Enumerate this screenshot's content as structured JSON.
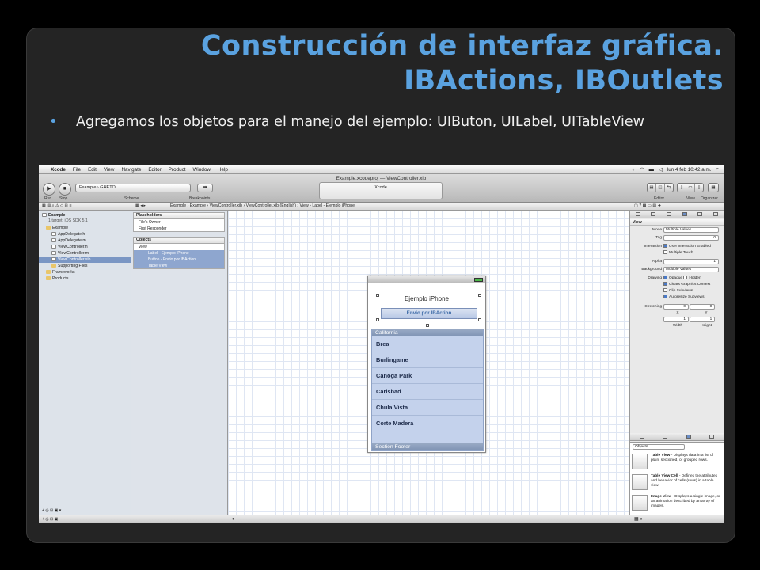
{
  "slide": {
    "title_line1": "Construcción de interfaz gráfica.",
    "title_line2": "IBActions, IBOutlets",
    "bullet": "Agregamos los objetos para el manejo del ejemplo: UIButon, UILabel, UITableView"
  },
  "menubar": {
    "apple": "",
    "items": [
      "Xcode",
      "File",
      "Edit",
      "View",
      "Navigate",
      "Editor",
      "Product",
      "Window",
      "Help"
    ],
    "clock": "lun 4 feb  10:42 a.m."
  },
  "window": {
    "title": "Example.xcodeproj — ViewController.xib",
    "activity": "Xcode",
    "run_label": "Run",
    "stop_label": "Stop",
    "scheme_value": "Example  ›  GHETO",
    "scheme_label": "Scheme",
    "breakpoints_label": "Breakpoints",
    "editor_label": "Editor",
    "view_label": "View",
    "organizer_label": "Organizer"
  },
  "jumpbar": {
    "path": "Example  ›  Example  ›  ViewController.xib  ›  ViewController.xib (English)  ›  View  ›  Label - Ejemplo iPhone"
  },
  "navigator": {
    "project": "Example",
    "project_sub": "1 target, iOS SDK 5.1",
    "items": [
      {
        "label": "Example",
        "kind": "folder",
        "indent": 1
      },
      {
        "label": "AppDelegate.h",
        "kind": "file",
        "indent": 2
      },
      {
        "label": "AppDelegate.m",
        "kind": "file",
        "indent": 2
      },
      {
        "label": "ViewController.h",
        "kind": "file",
        "indent": 2
      },
      {
        "label": "ViewController.m",
        "kind": "file",
        "indent": 2
      },
      {
        "label": "ViewController.xib",
        "kind": "file",
        "indent": 2,
        "selected": true
      },
      {
        "label": "Supporting Files",
        "kind": "folder",
        "indent": 2
      },
      {
        "label": "Frameworks",
        "kind": "folder",
        "indent": 1
      },
      {
        "label": "Products",
        "kind": "folder",
        "indent": 1
      }
    ]
  },
  "outline": {
    "placeholders_title": "Placeholders",
    "placeholders": [
      "File's Owner",
      "First Responder"
    ],
    "objects_title": "Objects",
    "view_label": "View",
    "children": [
      "Label - Ejemplo iPhone",
      "Button - Envio por IBAction",
      "Table View"
    ]
  },
  "canvas": {
    "label_text": "Ejemplo iPhone",
    "button_text": "Envio por IBAction",
    "section_header": "California",
    "cities": [
      "Brea",
      "Burlingame",
      "Canoga Park",
      "Carlsbad",
      "Chula Vista",
      "Corte Madera"
    ],
    "section_footer": "Section Footer"
  },
  "inspector": {
    "section_view": "View",
    "mode_label": "Mode",
    "mode_value": "Multiple Values",
    "tag_label": "Tag",
    "tag_value": "0",
    "interaction_label": "Interaction",
    "interaction_opts": [
      "User Interaction Enabled",
      "Multiple Touch"
    ],
    "alpha_label": "Alpha",
    "alpha_value": "1",
    "background_label": "Background",
    "background_value": "Multiple Values",
    "drawing_label": "Drawing",
    "drawing_opts": [
      "Opaque",
      "Hidden",
      "Clears Graphics Context",
      "Clip Subviews",
      "Autoresize Subviews"
    ],
    "stretching_label": "Stretching",
    "stretch_x": "0",
    "stretch_y": "0",
    "stretch_w": "1",
    "stretch_h": "1",
    "x_label": "X",
    "y_label": "Y",
    "width_label": "Width",
    "height_label": "Height",
    "library_filter": "Objects",
    "library": [
      {
        "name": "Table View",
        "desc": " - Displays data in a list of plain, sectioned, or grouped rows."
      },
      {
        "name": "Table View Cell",
        "desc": " - Defines the attributes and behavior of cells (rows) in a table view."
      },
      {
        "name": "Image View",
        "desc": " - Displays a single image, or an animation described by an array of images."
      }
    ]
  },
  "colors": {
    "title": "#5aa2e0",
    "slide_bg": "#242424",
    "selection": "#7b97c4"
  }
}
